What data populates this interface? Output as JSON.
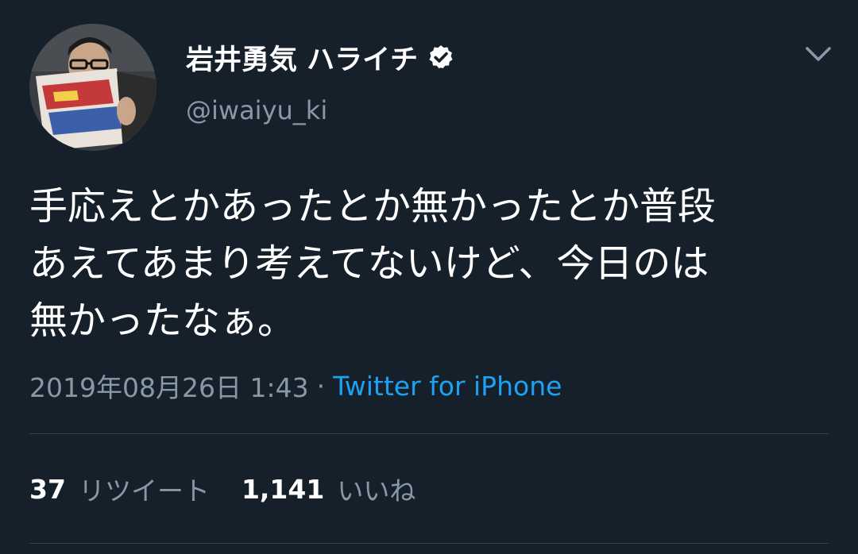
{
  "user": {
    "display_name": "岩井勇気 ハライチ",
    "handle": "@iwaiyu_ki",
    "verified_icon": "verified-badge-icon",
    "avatar_icon": "profile-photo"
  },
  "menu": {
    "icon": "chevron-down-icon"
  },
  "tweet": {
    "lines": [
      "手応えとかあったとか無かったとか普段",
      "あえてあまり考えてないけど、今日のは",
      "無かったなぁ。"
    ]
  },
  "meta": {
    "timestamp": "2019年08月26日 1:43",
    "separator": "·",
    "source": "Twitter for iPhone"
  },
  "stats": {
    "retweets": {
      "count": "37",
      "label": "リツイート"
    },
    "likes": {
      "count": "1,141",
      "label": "いいね"
    }
  },
  "colors": {
    "background": "#15202b",
    "secondary_text": "#8899a6",
    "accent": "#1da1f2",
    "divider": "#38444d"
  }
}
